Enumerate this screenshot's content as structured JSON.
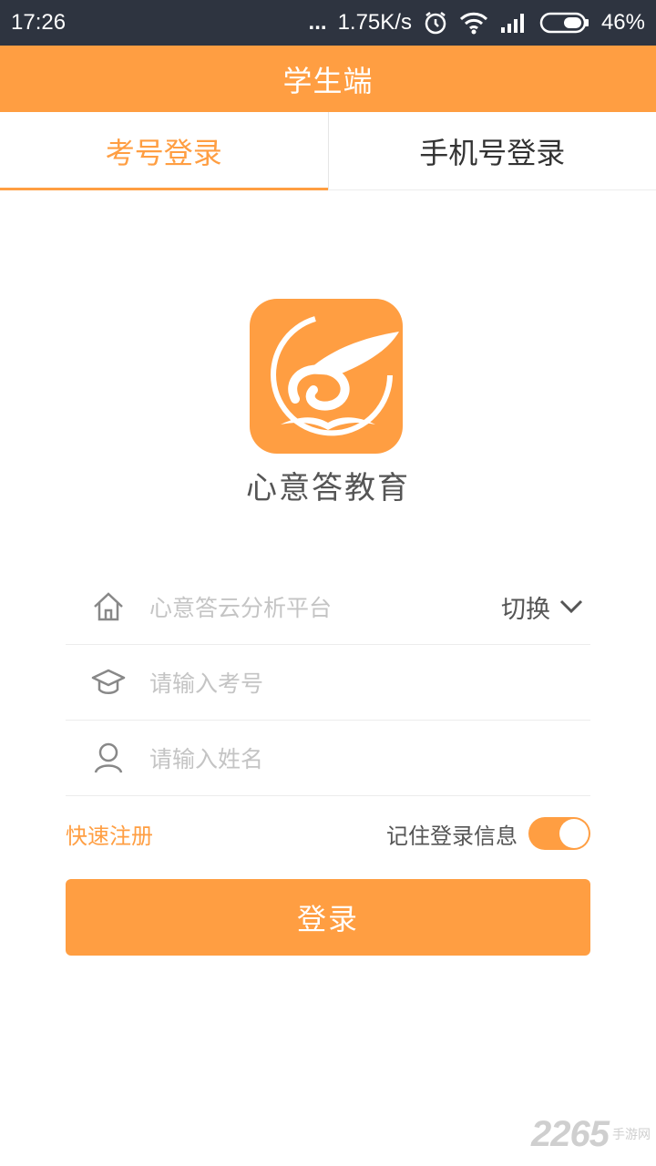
{
  "status_bar": {
    "time": "17:26",
    "dots": "...",
    "speed": "1.75K/s",
    "battery": "46%",
    "icons": [
      "alarm-icon",
      "wifi-icon",
      "signal-icon",
      "battery-icon"
    ]
  },
  "header": {
    "title": "学生端"
  },
  "tabs": [
    {
      "label": "考号登录",
      "active": true
    },
    {
      "label": "手机号登录",
      "active": false
    }
  ],
  "logo": {
    "app_name": "心意答教育"
  },
  "form": {
    "platform": {
      "placeholder": "心意答云分析平台",
      "switch_label": "切换"
    },
    "exam_no": {
      "placeholder": "请输入考号"
    },
    "name": {
      "placeholder": "请输入姓名"
    },
    "register_label": "快速注册",
    "remember_label": "记住登录信息",
    "remember_on": true,
    "login_label": "登录"
  },
  "watermark": {
    "number": "2265",
    "text": "手游网"
  },
  "colors": {
    "accent": "#ff9e42",
    "status_bar": "#2e3440"
  }
}
